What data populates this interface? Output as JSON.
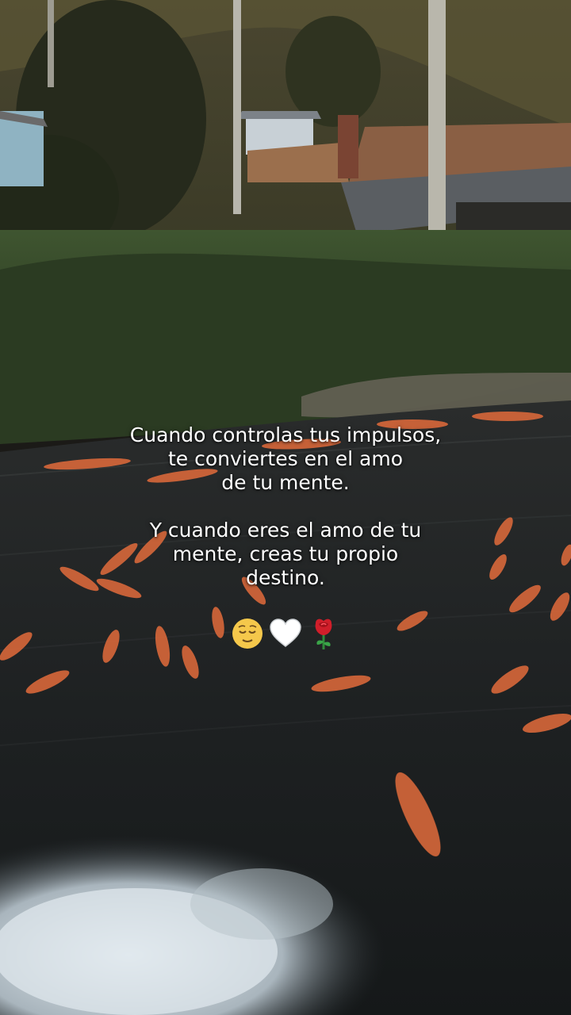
{
  "caption": {
    "lines_1": [
      "Cuando controlas tus impulsos,",
      "te conviertes en el amo",
      "de tu mente."
    ],
    "lines_2": [
      "Y cuando eres el amo de tu",
      "mente, creas tu propio",
      "destino."
    ]
  },
  "emojis": [
    "relieved-face-icon",
    "white-heart-icon",
    "rose-icon"
  ],
  "colors": {
    "text": "#ffffff",
    "fish": "#d9683a",
    "water": "#1e2224",
    "grass": "#2f4227"
  }
}
